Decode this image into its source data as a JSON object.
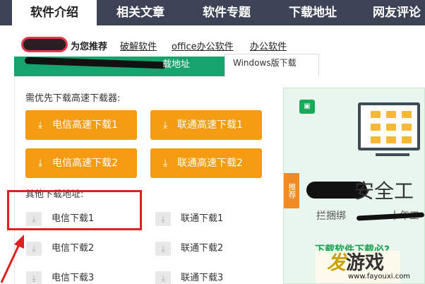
{
  "tabs": [
    "软件介绍",
    "相关文章",
    "软件专题",
    "下载地址",
    "网友评论"
  ],
  "recommend": {
    "prefix": "为您推荐",
    "links": [
      "破解软件",
      "office办公软件",
      "办公软件"
    ]
  },
  "subtabs": {
    "first_visible": "载地址",
    "second": "Windows版下载"
  },
  "fast_download": {
    "title": "需优先下载高速下载器:",
    "buttons": [
      "电信高速下载1",
      "联通高速下载1",
      "电信高速下载2",
      "联通高速下载2"
    ]
  },
  "other_download": {
    "title": "其他下载地址:",
    "items": [
      "电信下载1",
      "联通下载1",
      "电信下载2",
      "联通下载2",
      "电信下载3",
      "联通下载3"
    ]
  },
  "banner": {
    "badge": "推荐",
    "headline": "安全工",
    "subline_start": "拦捆绑",
    "subline_end": "十年工",
    "green_line": "下载软件下载必?"
  },
  "watermark": {
    "brand_first": "发",
    "brand_rest": "游戏",
    "url": "www.fayouxi.com"
  },
  "colors": {
    "tab_bar": "#3b4354",
    "green": "#17a36e",
    "orange": "#f39c12",
    "highlight": "#e0201f"
  }
}
